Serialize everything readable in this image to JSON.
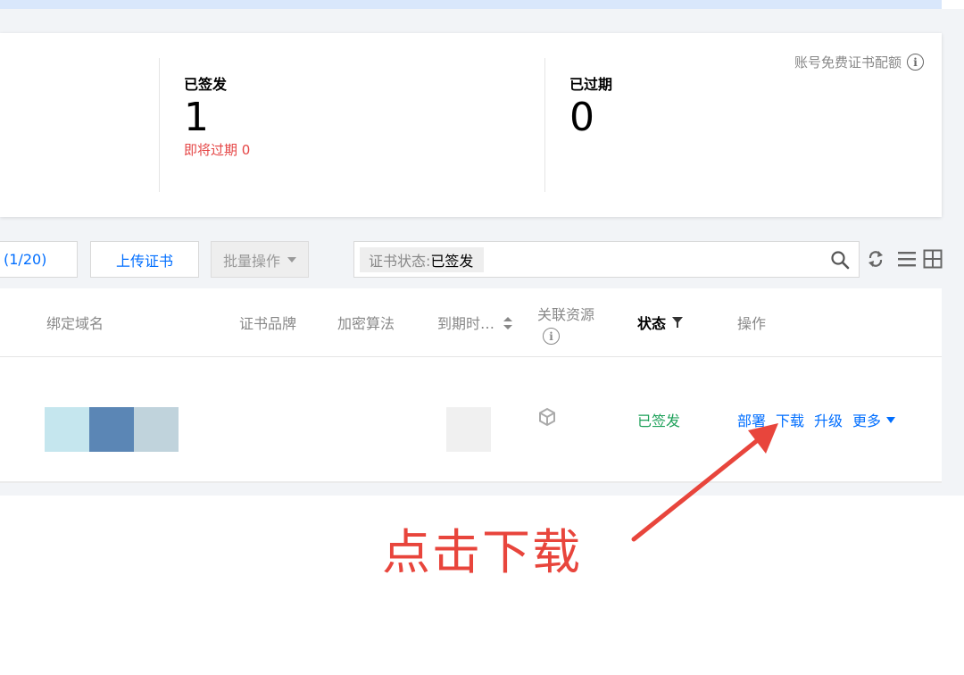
{
  "summary": {
    "issued_label": "已签发",
    "issued_value": "1",
    "expiring_label": "即将过期 0",
    "expired_label": "已过期",
    "expired_value": "0",
    "quota_label": "账号免费证书配额",
    "info_icon": "i"
  },
  "toolbar": {
    "quota_text": "(1/20)",
    "upload_label": "上传证书",
    "batch_label": "批量操作",
    "filter_key": "证书状态:",
    "filter_value": "已签发"
  },
  "table": {
    "columns": [
      "绑定域名",
      "证书品牌",
      "加密算法",
      "到期时…",
      "关联资源",
      "状态",
      "操作"
    ],
    "row": {
      "status": "已签发",
      "actions": [
        "部署",
        "下载",
        "升级",
        "更多"
      ]
    }
  },
  "annotation": {
    "text": "点击下载"
  },
  "colors": {
    "accent": "#006eff",
    "success": "#1ea15a",
    "danger": "#e54545",
    "annotation": "#e8453c"
  },
  "icons": [
    "info-icon",
    "search-icon",
    "refresh-icon",
    "list-view-icon",
    "grid-view-icon",
    "sort-icon",
    "filter-icon",
    "cube-icon",
    "chevron-down-icon",
    "arrow-icon"
  ]
}
